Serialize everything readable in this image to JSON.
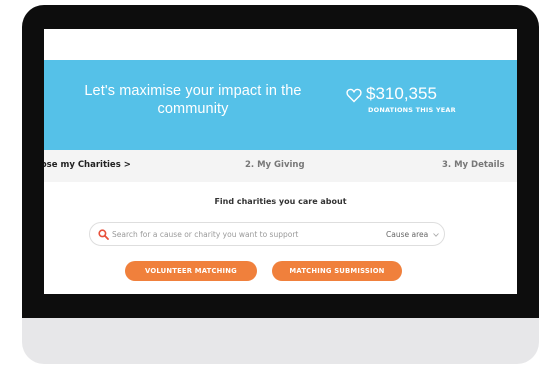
{
  "hero": {
    "headline": "Let's maximise your impact in the community",
    "donations_value": "$310,355",
    "donations_label": "DONATIONS THIS YEAR"
  },
  "steps": [
    {
      "label": "oose my Charities >"
    },
    {
      "label": "2. My Giving"
    },
    {
      "label": "3. My Details"
    }
  ],
  "search": {
    "title": "Find charities you care about",
    "placeholder": "Search for a cause or charity you want to support",
    "cause_area": "Cause area"
  },
  "buttons": {
    "volunteer": "VOLUNTEER MATCHING",
    "matching": "MATCHING SUBMISSION"
  },
  "colors": {
    "hero_blue": "#55c1e8",
    "accent_orange": "#f0803c",
    "search_icon_red": "#e8503a",
    "bezel": "#0d0d0d"
  },
  "icons": [
    "heart-icon",
    "search-icon",
    "chevron-down-icon"
  ]
}
